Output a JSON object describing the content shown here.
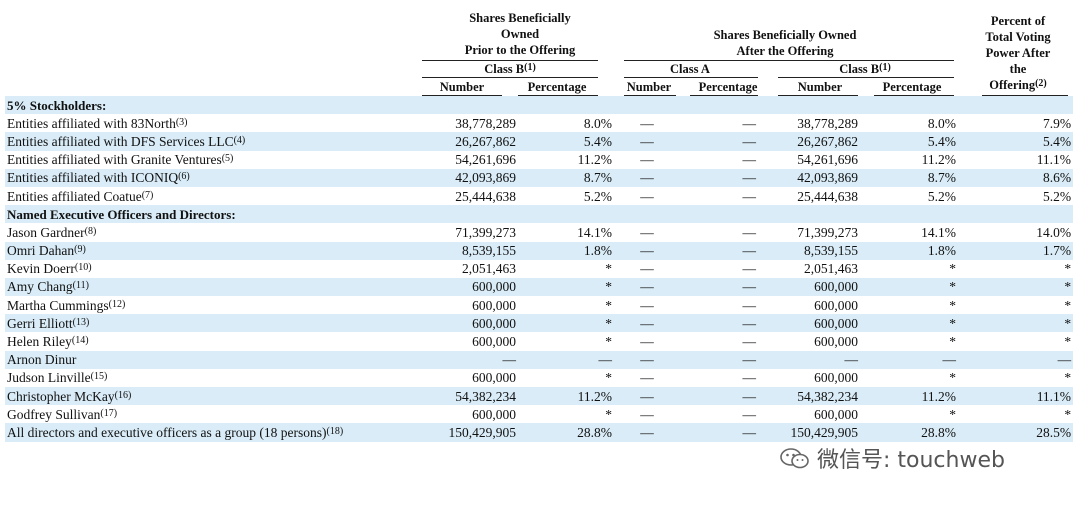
{
  "header": {
    "before_title": "Shares Beneficially Owned Prior to the Offering",
    "before_line1": "Shares Beneficially",
    "before_line2": "Owned",
    "before_line3": "Prior to the Offering",
    "before_class": "Class B",
    "before_class_note": "(1)",
    "after_line1": "Shares Beneficially Owned",
    "after_line2": "After the Offering",
    "after_class_a": "Class A",
    "after_class_b": "Class B",
    "after_class_b_note": "(1)",
    "pct_line1": "Percent of",
    "pct_line2": "Total Voting",
    "pct_line3": "Power After",
    "pct_line4": "the",
    "pct_line5": "Offering",
    "pct_note": "(2)",
    "col_number": "Number",
    "col_percentage": "Percentage"
  },
  "rows": [
    {
      "type": "section",
      "name": "5% Stockholders:"
    },
    {
      "name": "Entities affiliated with 83North",
      "note": "(3)",
      "b_num": "38,778,289",
      "b_pct": "8.0%",
      "a_num": "—",
      "a_pct": "—",
      "ab_num": "38,778,289",
      "ab_pct": "8.0%",
      "vote": "7.9%"
    },
    {
      "name": "Entities affiliated with DFS Services LLC",
      "note": "(4)",
      "b_num": "26,267,862",
      "b_pct": "5.4%",
      "a_num": "—",
      "a_pct": "—",
      "ab_num": "26,267,862",
      "ab_pct": "5.4%",
      "vote": "5.4%"
    },
    {
      "name": "Entities affiliated with Granite Ventures",
      "note": "(5)",
      "b_num": "54,261,696",
      "b_pct": "11.2%",
      "a_num": "—",
      "a_pct": "—",
      "ab_num": "54,261,696",
      "ab_pct": "11.2%",
      "vote": "11.1%"
    },
    {
      "name": "Entities affiliated with ICONIQ",
      "note": "(6)",
      "b_num": "42,093,869",
      "b_pct": "8.7%",
      "a_num": "—",
      "a_pct": "—",
      "ab_num": "42,093,869",
      "ab_pct": "8.7%",
      "vote": "8.6%"
    },
    {
      "name": "Entities affiliated Coatue",
      "note": "(7)",
      "b_num": "25,444,638",
      "b_pct": "5.2%",
      "a_num": "—",
      "a_pct": "—",
      "ab_num": "25,444,638",
      "ab_pct": "5.2%",
      "vote": "5.2%"
    },
    {
      "type": "section",
      "name": "Named Executive Officers and Directors:"
    },
    {
      "name": "Jason Gardner",
      "note": "(8)",
      "b_num": "71,399,273",
      "b_pct": "14.1%",
      "a_num": "—",
      "a_pct": "—",
      "ab_num": "71,399,273",
      "ab_pct": "14.1%",
      "vote": "14.0%"
    },
    {
      "name": "Omri Dahan",
      "note": "(9)",
      "b_num": "8,539,155",
      "b_pct": "1.8%",
      "a_num": "—",
      "a_pct": "—",
      "ab_num": "8,539,155",
      "ab_pct": "1.8%",
      "vote": "1.7%"
    },
    {
      "name": "Kevin Doerr",
      "note": "(10)",
      "b_num": "2,051,463",
      "b_pct": "*",
      "a_num": "—",
      "a_pct": "—",
      "ab_num": "2,051,463",
      "ab_pct": "*",
      "vote": "*"
    },
    {
      "name": "Amy Chang",
      "note": "(11)",
      "b_num": "600,000",
      "b_pct": "*",
      "a_num": "—",
      "a_pct": "—",
      "ab_num": "600,000",
      "ab_pct": "*",
      "vote": "*"
    },
    {
      "name": "Martha Cummings",
      "note": "(12)",
      "b_num": "600,000",
      "b_pct": "*",
      "a_num": "—",
      "a_pct": "—",
      "ab_num": "600,000",
      "ab_pct": "*",
      "vote": "*"
    },
    {
      "name": "Gerri Elliott",
      "note": "(13)",
      "b_num": "600,000",
      "b_pct": "*",
      "a_num": "—",
      "a_pct": "—",
      "ab_num": "600,000",
      "ab_pct": "*",
      "vote": "*"
    },
    {
      "name": "Helen Riley",
      "note": "(14)",
      "b_num": "600,000",
      "b_pct": "*",
      "a_num": "—",
      "a_pct": "—",
      "ab_num": "600,000",
      "ab_pct": "*",
      "vote": "*"
    },
    {
      "name": "Arnon Dinur",
      "note": "",
      "b_num": "—",
      "b_pct": "—",
      "a_num": "—",
      "a_pct": "—",
      "ab_num": "—",
      "ab_pct": "—",
      "vote": "—"
    },
    {
      "name": "Judson Linville",
      "note": "(15)",
      "b_num": "600,000",
      "b_pct": "*",
      "a_num": "—",
      "a_pct": "—",
      "ab_num": "600,000",
      "ab_pct": "*",
      "vote": "*"
    },
    {
      "name": "Christopher McKay",
      "note": "(16)",
      "b_num": "54,382,234",
      "b_pct": "11.2%",
      "a_num": "—",
      "a_pct": "—",
      "ab_num": "54,382,234",
      "ab_pct": "11.2%",
      "vote": "11.1%"
    },
    {
      "name": "Godfrey Sullivan",
      "note": "(17)",
      "b_num": "600,000",
      "b_pct": "*",
      "a_num": "—",
      "a_pct": "—",
      "ab_num": "600,000",
      "ab_pct": "*",
      "vote": "*"
    },
    {
      "name": "All directors and executive officers as a group (18 persons)",
      "note": "(18)",
      "b_num": "150,429,905",
      "b_pct": "28.8%",
      "a_num": "—",
      "a_pct": "—",
      "ab_num": "150,429,905",
      "ab_pct": "28.8%",
      "vote": "28.5%"
    }
  ],
  "watermark": {
    "text": "微信号: touchweb",
    "icon": "wechat-icon"
  },
  "colors": {
    "row_shade": "#d9ecf7",
    "text": "#111111"
  }
}
